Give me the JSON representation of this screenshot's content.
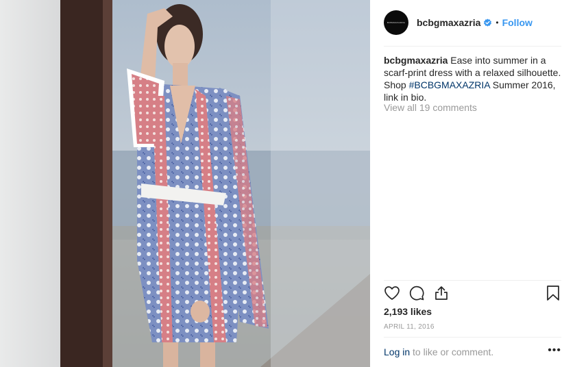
{
  "post": {
    "image_alt": "Model in scarf-print dress standing behind a window",
    "avatar_text": "BCBGMAXAZRIA"
  },
  "header": {
    "username": "bcbgmaxazria",
    "verified_icon": "verified-badge-icon",
    "separator": "•",
    "follow_label": "Follow"
  },
  "caption": {
    "username": "bcbgmaxazria",
    "text_before": " Ease into summer in a scarf-print dress with a relaxed silhouette. Shop ",
    "hashtag": "#BCBGMAXAZRIA",
    "text_after": " Summer 2016, link in bio."
  },
  "comments": {
    "view_all": "View all 19 comments"
  },
  "actions": {
    "like_icon": "heart-icon",
    "comment_icon": "comment-icon",
    "share_icon": "share-icon",
    "save_icon": "bookmark-icon"
  },
  "likes": "2,193 likes",
  "date": "APRIL 11, 2016",
  "login": {
    "link": "Log in",
    "rest": " to like or comment."
  },
  "more_label": "•••",
  "colors": {
    "accent": "#3897f0",
    "link": "#003569",
    "muted": "#999999",
    "text": "#262626"
  }
}
